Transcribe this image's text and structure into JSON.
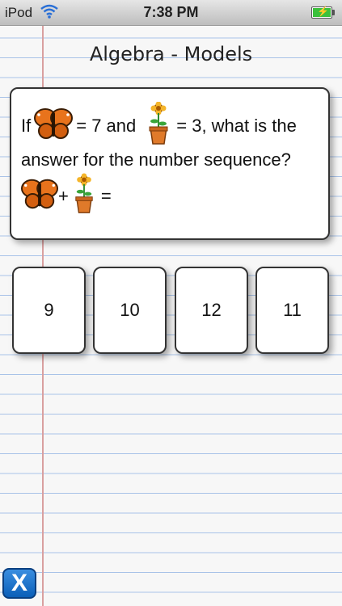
{
  "status_bar": {
    "device": "iPod",
    "time": "7:38 PM",
    "wifi_icon": "wifi-icon",
    "battery_icon": "battery-charging-icon"
  },
  "title": "Algebra - Models",
  "question": {
    "part1": "If",
    "part2": "= 7 and",
    "part3": "= 3, what is the",
    "line2": "answer for the number sequence?",
    "plus": "+",
    "equals": "=",
    "icons": [
      "butterfly-icon",
      "flower-pot-icon"
    ]
  },
  "answers": [
    "9",
    "10",
    "12",
    "11"
  ],
  "close_button": {
    "label": "X",
    "icon": "close-icon"
  },
  "colors": {
    "paper": "#f7f7f7",
    "rule_line": "#a9c3e8",
    "margin_line": "#d9a0a0",
    "close_button": "#1a6fcc"
  }
}
